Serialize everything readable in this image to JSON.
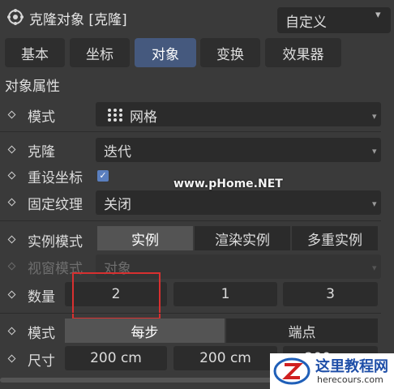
{
  "header": {
    "title": "克隆对象 [克隆]",
    "preset": "自定义"
  },
  "tabs": [
    "基本",
    "坐标",
    "对象",
    "变换",
    "效果器"
  ],
  "active_tab": "对象",
  "section_title": "对象属性",
  "props": {
    "mode_label": "模式",
    "mode_value": "网格",
    "clone_label": "克隆",
    "clone_value": "迭代",
    "reset_coords_label": "重设坐标",
    "reset_coords_checked": true,
    "fix_texture_label": "固定纹理",
    "fix_texture_value": "关闭",
    "instance_mode_label": "实例模式",
    "instance_options": [
      "实例",
      "渲染实例",
      "多重实例"
    ],
    "instance_selected": "实例",
    "viewport_mode_label": "视窗模式",
    "viewport_mode_value": "对象",
    "count_label": "数量",
    "count_values": [
      "2",
      "1",
      "3"
    ],
    "mode2_label": "模式",
    "mode2_options": [
      "每步",
      "端点"
    ],
    "mode2_selected": "每步",
    "size_label": "尺寸",
    "size_values": [
      "200 cm",
      "200 cm",
      "200 cm"
    ]
  },
  "watermark": "www.pHome.NET",
  "logo": {
    "main": "这里教程网",
    "sub": "herecours.com"
  },
  "colors": {
    "active_tab": "#45597e",
    "highlight": "#d83030",
    "checkbox": "#5a7fbf"
  }
}
